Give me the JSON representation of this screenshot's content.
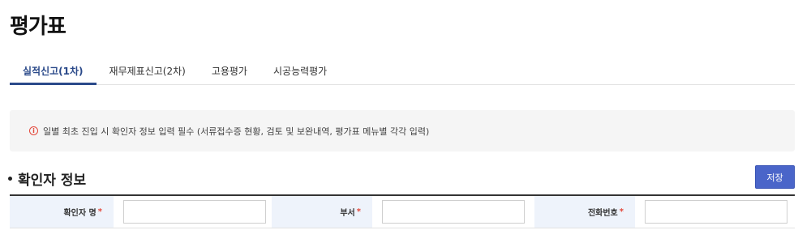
{
  "page": {
    "title": "평가표"
  },
  "tabs": [
    {
      "label": "실적신고(1차)",
      "active": true
    },
    {
      "label": "재무제표신고(2차)",
      "active": false
    },
    {
      "label": "고용평가",
      "active": false
    },
    {
      "label": "시공능력평가",
      "active": false
    }
  ],
  "notice": {
    "icon": "info-icon",
    "text": "일별 최초 진입 시 확인자 정보 입력 필수 (서류접수증 현황, 검토 및 보완내역, 평가표 메뉴별 각각 입력)"
  },
  "section": {
    "title": "확인자 정보",
    "save_label": "저장"
  },
  "fields": [
    {
      "label": "확인자 명",
      "required_mark": "*",
      "value": ""
    },
    {
      "label": "부서",
      "required_mark": "*",
      "value": ""
    },
    {
      "label": "전화번호",
      "required_mark": "*",
      "value": ""
    }
  ],
  "colors": {
    "accent": "#2b4a8a",
    "button": "#4a65c9",
    "required": "#e3483b",
    "header_bg": "#eef3fb"
  }
}
